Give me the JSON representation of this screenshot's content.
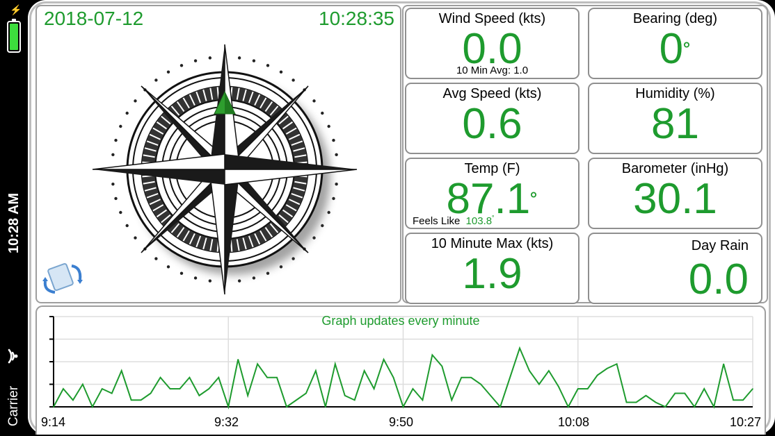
{
  "status_bar": {
    "time": "10:28 AM",
    "carrier": "Carrier",
    "battery_level": 1.0,
    "battery_color": "#3ddc3d",
    "icons": [
      "battery-icon",
      "charging-bolt-icon",
      "wifi-icon"
    ]
  },
  "header": {
    "date": "2018-07-12",
    "time": "10:28:35"
  },
  "compass": {
    "bearing_deg": 0,
    "icons": [
      "compass-rose-icon",
      "bearing-arrow-icon",
      "rotate-device-icon"
    ]
  },
  "tiles": {
    "wind_speed": {
      "label": "Wind Speed (kts)",
      "value": "0.0",
      "sub": "10 Min Avg: 1.0"
    },
    "bearing": {
      "label": "Bearing (deg)",
      "value": "0"
    },
    "avg_speed": {
      "label": "Avg Speed (kts)",
      "value": "0.6"
    },
    "humidity": {
      "label": "Humidity (%)",
      "value": "81"
    },
    "temp": {
      "label": "Temp (F)",
      "value": "87.1",
      "feels_like_label": "Feels Like",
      "feels_like_value": "103.8"
    },
    "barometer": {
      "label": "Barometer (inHg)",
      "value": "30.1"
    },
    "max10": {
      "label": "10 Minute Max (kts)",
      "value": "1.9"
    },
    "day_rain": {
      "label": "Day Rain",
      "value": "0.0"
    },
    "degree_symbol": "˚"
  },
  "colors": {
    "accent_green": "#1e9b2e",
    "border_gray": "#9e9e9e"
  },
  "chart_data": {
    "type": "line",
    "title": "Graph updates every minute",
    "x_tick_labels": [
      "9:14",
      "9:32",
      "9:50",
      "10:08",
      "10:27"
    ],
    "ylim": [
      0,
      4
    ],
    "grid": true,
    "series": [
      {
        "values": [
          0.0,
          0.8,
          0.3,
          1.0,
          0.0,
          0.8,
          0.6,
          1.6,
          0.3,
          0.3,
          0.6,
          1.3,
          0.8,
          0.8,
          1.3,
          0.5,
          0.8,
          1.3,
          0.0,
          2.1,
          0.5,
          1.9,
          1.3,
          1.3,
          0.0,
          0.3,
          0.6,
          1.6,
          0.0,
          1.9,
          0.5,
          0.3,
          1.6,
          0.8,
          2.1,
          1.3,
          0.0,
          0.8,
          0.3,
          2.3,
          1.8,
          0.3,
          1.3,
          1.3,
          1.0,
          0.5,
          0.0,
          1.3,
          2.6,
          1.6,
          1.0,
          1.6,
          0.9,
          0.0,
          0.8,
          0.8,
          1.4,
          1.7,
          1.9,
          0.2,
          0.2,
          0.5,
          0.2,
          0.0,
          0.6,
          0.6,
          0.0,
          0.8,
          0.0,
          1.9,
          0.3,
          0.3,
          0.8
        ]
      }
    ]
  }
}
